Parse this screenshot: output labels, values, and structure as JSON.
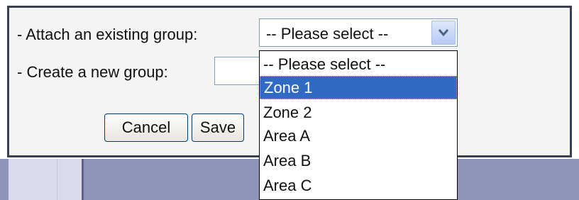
{
  "form": {
    "attach_label": "- Attach an existing group:",
    "create_label": "- Create a new group:",
    "select_value": "-- Please select --",
    "new_group_value": "",
    "cancel_label": "Cancel",
    "save_label": "Save"
  },
  "dropdown": {
    "options": [
      "-- Please select --",
      "Zone 1",
      "Zone 2",
      "Area A",
      "Area B",
      "Area C"
    ],
    "highlighted": "Zone 1"
  },
  "colors": {
    "highlight": "#316ac5",
    "panel_border": "#3a3f52",
    "panel_background": "#f4f4f4",
    "page_background_strip": "#8e95b8"
  },
  "icons": {
    "select_arrow": "chevron-down-icon"
  }
}
